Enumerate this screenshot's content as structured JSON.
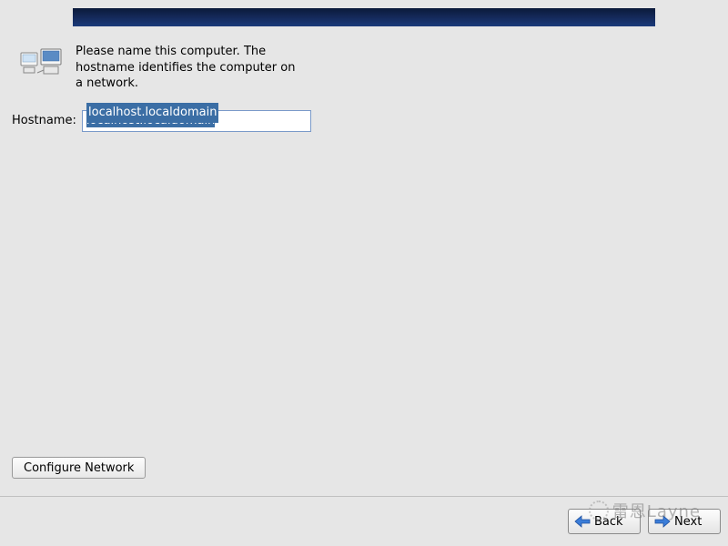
{
  "banner": {},
  "description": "Please name this computer.  The hostname identifies the computer on a network.",
  "hostname": {
    "label": "Hostname:",
    "value": "localhost.localdomain"
  },
  "buttons": {
    "configure_network": "Configure Network",
    "back": "Back",
    "next": "Next"
  },
  "watermark": "雷恩Layne"
}
